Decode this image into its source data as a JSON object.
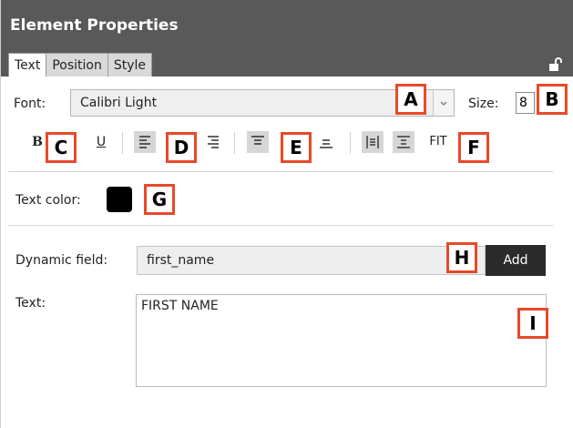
{
  "panel": {
    "title": "Element Properties",
    "tabs": [
      {
        "label": "Text",
        "active": true
      },
      {
        "label": "Position",
        "active": false
      },
      {
        "label": "Style",
        "active": false
      }
    ],
    "lock_icon": "padlock-icon"
  },
  "font": {
    "label": "Font:",
    "value": "Calibri Light",
    "dropdown_icon": "chevron-down-icon"
  },
  "size": {
    "label": "Size:",
    "value": "8"
  },
  "format": {
    "bold": "B",
    "underline": "U",
    "fit": "FIT"
  },
  "text_color": {
    "label": "Text color:",
    "color": "#000000"
  },
  "dynamic_field": {
    "label": "Dynamic field:",
    "value": "first_name",
    "add_label": "Add"
  },
  "text": {
    "label": "Text:",
    "value": "FIRST NAME"
  },
  "callouts": [
    "A",
    "B",
    "C",
    "D",
    "E",
    "F",
    "G",
    "H",
    "I"
  ],
  "colors": {
    "header": "#595959",
    "callout_border": "#e8492a",
    "add_button": "#2b2b2b"
  }
}
